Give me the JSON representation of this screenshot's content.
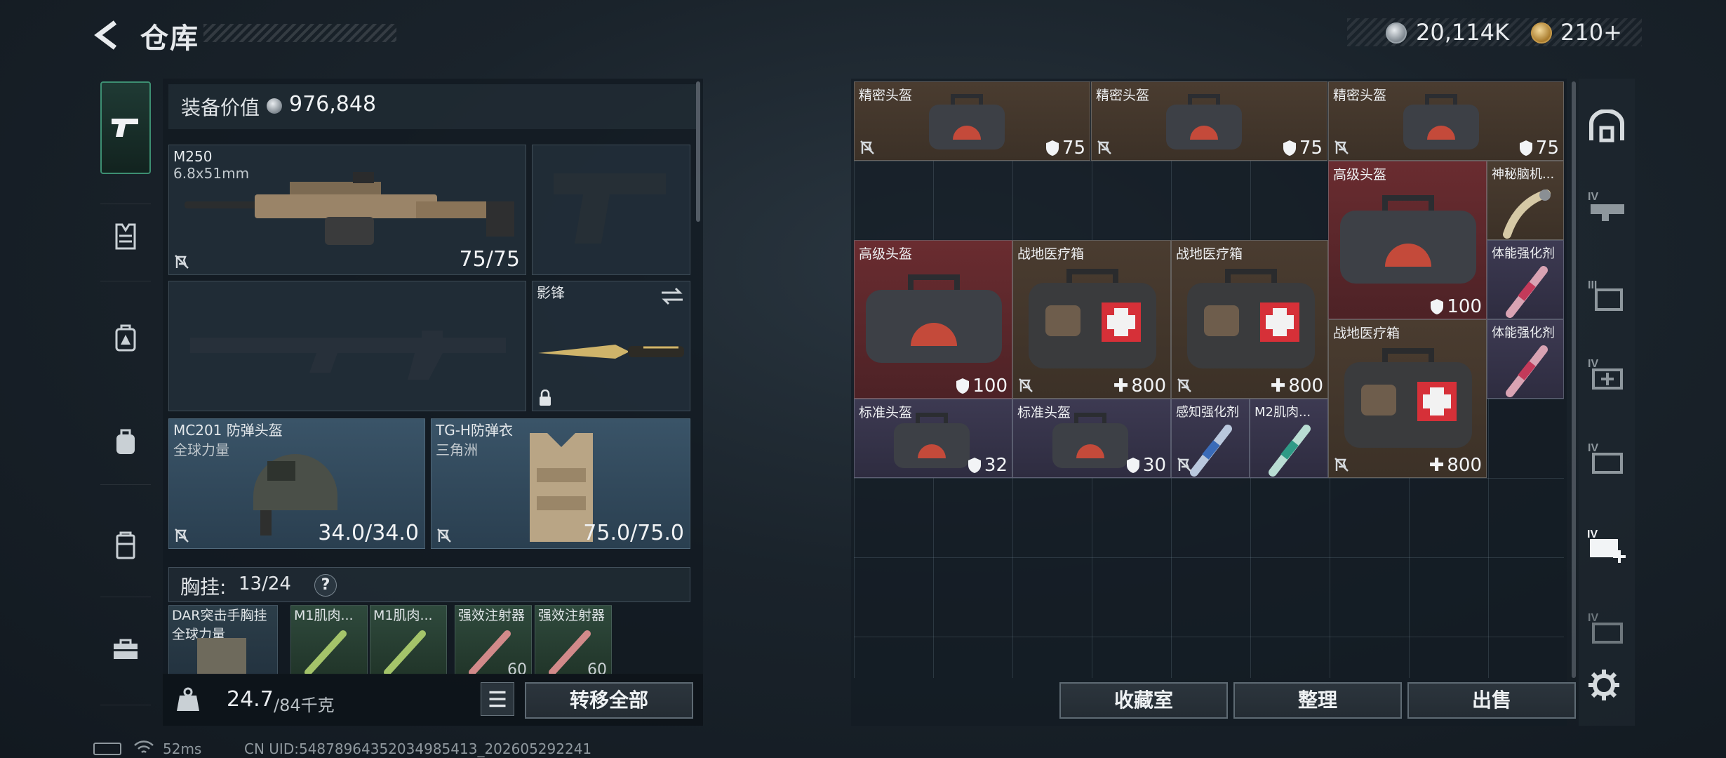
{
  "header": {
    "title": "仓库",
    "currency_silver": "20,114K",
    "currency_gold": "210+"
  },
  "loadout": {
    "equip_value_label": "装备价值",
    "equip_value": "976,848",
    "primary": {
      "name": "M250",
      "ammo": "6.8x51mm",
      "durability": "75/75"
    },
    "secondary_slot_empty": true,
    "knife": {
      "name": "影锋"
    },
    "helmet": {
      "name": "MC201 防弹头盔",
      "sub": "全球力量",
      "durability": "34.0/34.0"
    },
    "armor": {
      "name": "TG-H防弹衣",
      "sub": "三角洲",
      "durability": "75.0/75.0"
    },
    "chest_label": "胸挂:",
    "chest_value": "13/24",
    "chest_help": "?",
    "chest_items": [
      {
        "name": "DAR突击手胸挂",
        "sub": "全球力量",
        "num": ""
      },
      {
        "name": "M1肌肉...",
        "sub": "",
        "num": ""
      },
      {
        "name": "M1肌肉...",
        "sub": "",
        "num": ""
      },
      {
        "name": "强效注射器",
        "sub": "",
        "num": "60"
      },
      {
        "name": "强效注射器",
        "sub": "",
        "num": "60"
      }
    ],
    "weight_value": "24.7",
    "weight_max": "/84千克",
    "transfer_all": "转移全部"
  },
  "stash": {
    "items": [
      {
        "name": "精密头盔",
        "value": "75",
        "type": "armor"
      },
      {
        "name": "精密头盔",
        "value": "75",
        "type": "armor"
      },
      {
        "name": "精密头盔",
        "value": "75",
        "type": "armor"
      },
      {
        "name": "高级头盔",
        "value": "100",
        "type": "armor"
      },
      {
        "name": "神秘脑机...",
        "value": "",
        "type": ""
      },
      {
        "name": "高级头盔",
        "value": "100",
        "type": "armor"
      },
      {
        "name": "战地医疗箱",
        "value": "800",
        "type": "heal"
      },
      {
        "name": "战地医疗箱",
        "value": "800",
        "type": "heal"
      },
      {
        "name": "体能强化剂",
        "value": "",
        "type": ""
      },
      {
        "name": "战地医疗箱",
        "value": "800",
        "type": "heal"
      },
      {
        "name": "体能强化剂",
        "value": "",
        "type": ""
      },
      {
        "name": "标准头盔",
        "value": "32",
        "type": "armor"
      },
      {
        "name": "标准头盔",
        "value": "30",
        "type": "armor"
      },
      {
        "name": "感知强化剂",
        "value": "",
        "type": ""
      },
      {
        "name": "M2肌肉...",
        "value": "",
        "type": ""
      }
    ],
    "buttons": {
      "vault": "收藏室",
      "sort": "整理",
      "sell": "出售"
    }
  },
  "status": {
    "ping": "52ms",
    "uid": "CN UID:548789643520349854​13_202605292241"
  },
  "colors": {
    "accent_green": "#3d8f72",
    "rarity_brown": "#4a3c30",
    "rarity_red": "#6a2c30",
    "rarity_purple": "#3d3a52",
    "rarity_blue": "#3a5468"
  },
  "icons": {
    "nav": [
      "pistol-icon",
      "vest-icon",
      "backpack-armor-icon",
      "backpack-icon",
      "safebox-icon",
      "toolbox-icon"
    ],
    "rail": [
      "stash-gate-icon",
      "iv-weapon-icon",
      "iii-armor-icon",
      "iv-heal-icon",
      "iv-ammo-icon",
      "iv-add-icon",
      "iv-misc-icon"
    ]
  }
}
